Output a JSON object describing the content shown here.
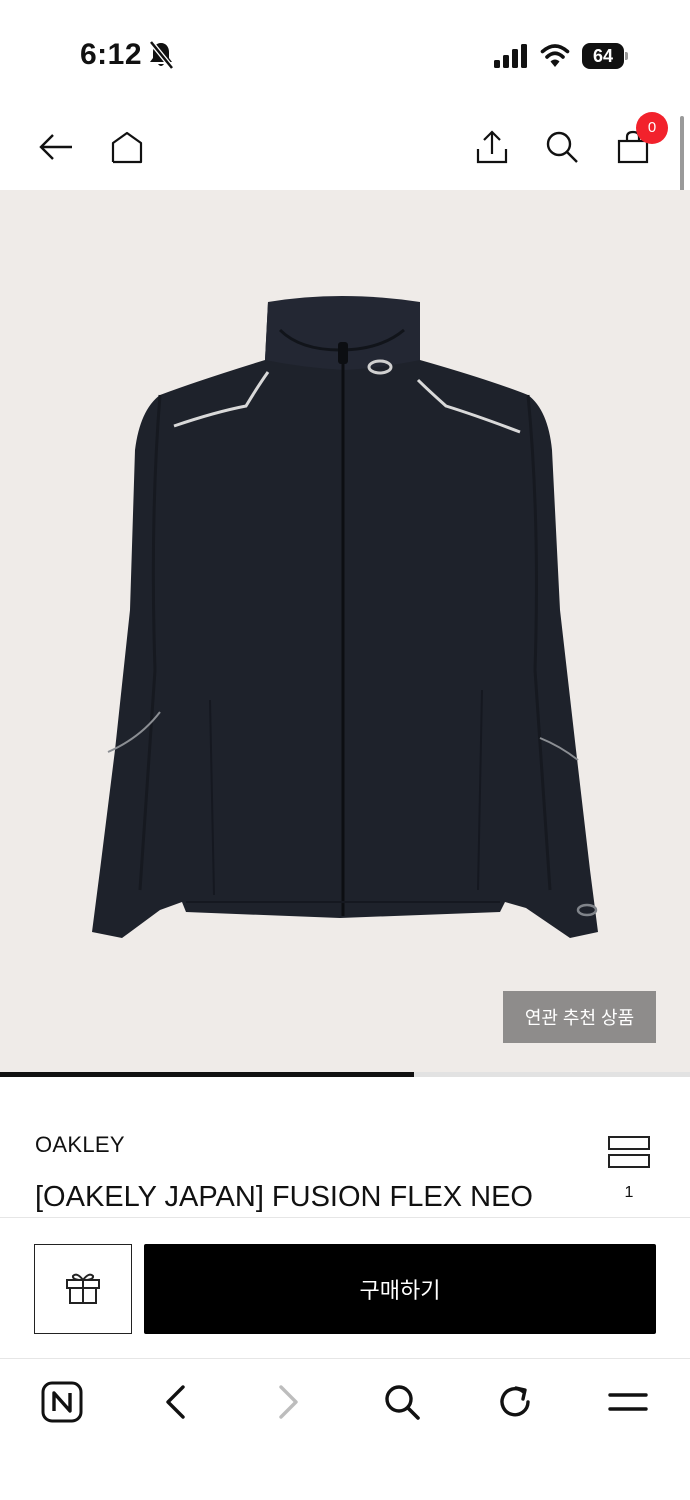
{
  "status_bar": {
    "time": "6:12",
    "battery": "64",
    "icons": [
      "bell-slash-icon",
      "signal-icon",
      "wifi-icon",
      "battery-icon"
    ]
  },
  "header": {
    "icons": [
      "back-arrow-icon",
      "home-icon",
      "share-icon",
      "search-icon",
      "cart-icon"
    ],
    "cart_count": "0"
  },
  "gallery": {
    "related_button_label": "연관 추천 상품",
    "progress_fraction": 0.6
  },
  "product": {
    "brand": "OAKLEY",
    "title": "[OAKELY JAPAN] FUSION FLEX NEO",
    "view_count": "1"
  },
  "purchase": {
    "buy_label": "구매하기",
    "gift_icon": "gift-icon"
  },
  "browser_toolbar": {
    "icons": [
      "naver-n-icon",
      "back-chevron-icon",
      "forward-chevron-icon",
      "search-icon",
      "reload-icon",
      "menu-icon"
    ]
  },
  "colors": {
    "badge": "#f2222c",
    "image_background": "#efebe8",
    "jacket": "#1e222b",
    "related_button": "#8e8c8b"
  }
}
